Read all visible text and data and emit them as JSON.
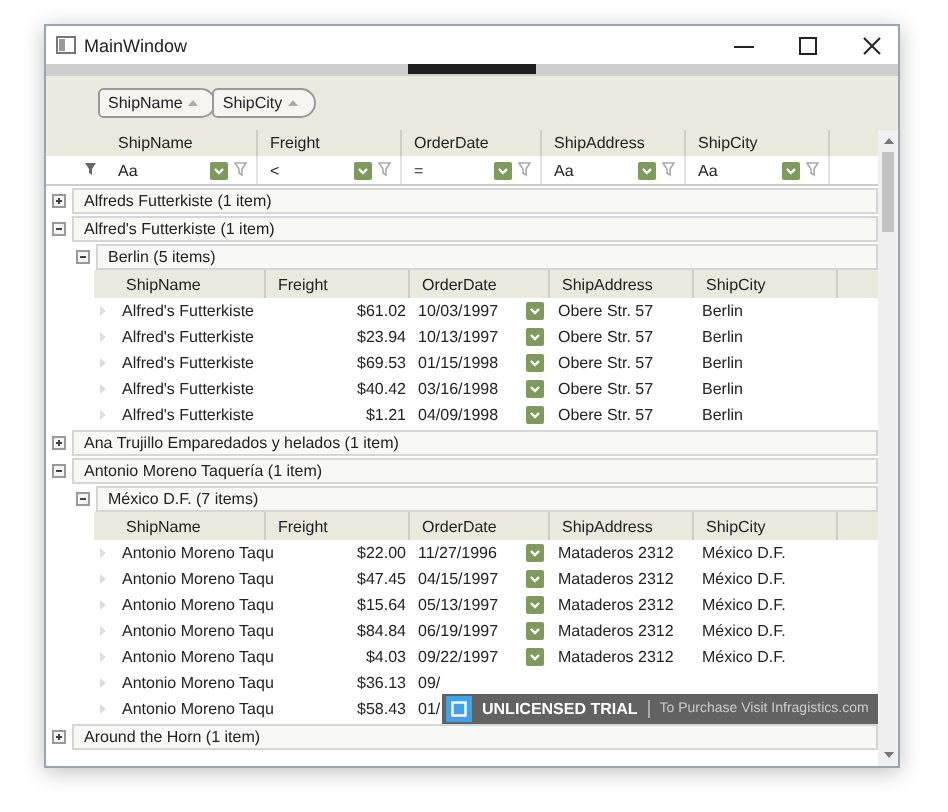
{
  "window": {
    "title": "MainWindow"
  },
  "group_by": [
    {
      "label": "ShipName"
    },
    {
      "label": "ShipCity"
    }
  ],
  "columns": [
    "ShipName",
    "Freight",
    "OrderDate",
    "ShipAddress",
    "ShipCity"
  ],
  "filter_row": [
    {
      "operator": "Aa"
    },
    {
      "operator": "<"
    },
    {
      "operator": "="
    },
    {
      "operator": "Aa"
    },
    {
      "operator": "Aa"
    }
  ],
  "groups": [
    {
      "label": "Alfreds Futterkiste (1 item)",
      "expanded": false
    },
    {
      "label": "Alfred's Futterkiste (1 item)",
      "expanded": true,
      "children": [
        {
          "label": "Berlin (5 items)",
          "expanded": true,
          "columns": [
            "ShipName",
            "Freight",
            "OrderDate",
            "ShipAddress",
            "ShipCity"
          ],
          "rows": [
            {
              "ship_name": "Alfred's Futterkiste",
              "freight": "$61.02",
              "order_date": "10/03/1997",
              "ship_address": "Obere Str. 57",
              "ship_city": "Berlin"
            },
            {
              "ship_name": "Alfred's Futterkiste",
              "freight": "$23.94",
              "order_date": "10/13/1997",
              "ship_address": "Obere Str. 57",
              "ship_city": "Berlin"
            },
            {
              "ship_name": "Alfred's Futterkiste",
              "freight": "$69.53",
              "order_date": "01/15/1998",
              "ship_address": "Obere Str. 57",
              "ship_city": "Berlin"
            },
            {
              "ship_name": "Alfred's Futterkiste",
              "freight": "$40.42",
              "order_date": "03/16/1998",
              "ship_address": "Obere Str. 57",
              "ship_city": "Berlin"
            },
            {
              "ship_name": "Alfred's Futterkiste",
              "freight": "$1.21",
              "order_date": "04/09/1998",
              "ship_address": "Obere Str. 57",
              "ship_city": "Berlin"
            }
          ]
        }
      ]
    },
    {
      "label": "Ana Trujillo Emparedados y helados (1 item)",
      "expanded": false
    },
    {
      "label": "Antonio Moreno Taquería (1 item)",
      "expanded": true,
      "children": [
        {
          "label": "México D.F. (7 items)",
          "expanded": true,
          "columns": [
            "ShipName",
            "Freight",
            "OrderDate",
            "ShipAddress",
            "ShipCity"
          ],
          "rows": [
            {
              "ship_name": "Antonio Moreno Taqu",
              "freight": "$22.00",
              "order_date": "11/27/1996",
              "ship_address": "Mataderos  2312",
              "ship_city": "México D.F."
            },
            {
              "ship_name": "Antonio Moreno Taqu",
              "freight": "$47.45",
              "order_date": "04/15/1997",
              "ship_address": "Mataderos  2312",
              "ship_city": "México D.F."
            },
            {
              "ship_name": "Antonio Moreno Taqu",
              "freight": "$15.64",
              "order_date": "05/13/1997",
              "ship_address": "Mataderos  2312",
              "ship_city": "México D.F."
            },
            {
              "ship_name": "Antonio Moreno Taqu",
              "freight": "$84.84",
              "order_date": "06/19/1997",
              "ship_address": "Mataderos  2312",
              "ship_city": "México D.F."
            },
            {
              "ship_name": "Antonio Moreno Taqu",
              "freight": "$4.03",
              "order_date": "09/22/1997",
              "ship_address": "Mataderos  2312",
              "ship_city": "México D.F."
            },
            {
              "ship_name": "Antonio Moreno Taqu",
              "freight": "$36.13",
              "order_date": "09/"
            },
            {
              "ship_name": "Antonio Moreno Taqu",
              "freight": "$58.43",
              "order_date": "01/"
            }
          ]
        }
      ]
    },
    {
      "label": "Around the Horn (1 item)",
      "expanded": false
    }
  ],
  "banner": {
    "title": "UNLICENSED TRIAL",
    "text": "To Purchase Visit Infragistics.com"
  }
}
